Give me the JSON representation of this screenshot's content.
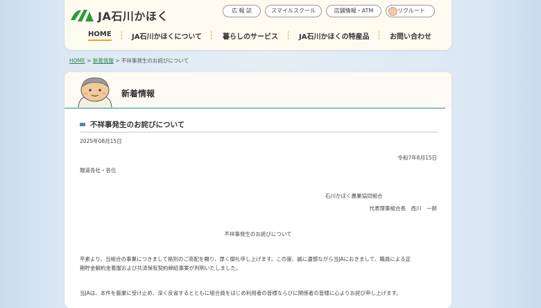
{
  "header": {
    "logo_text": "JA石川かほく",
    "top_links": [
      "広 報 誌",
      "スマイルスクール",
      "店舗情報・ATM",
      "リクルート"
    ],
    "nav": [
      "HOME",
      "JA石川かほくについて",
      "暮らしのサービス",
      "JA石川かほくの特産品",
      "お問い合わせ"
    ]
  },
  "breadcrumb": {
    "home": "HOME",
    "sep1": " > ",
    "news": "新着情報",
    "sep2": " > ",
    "current": "不祥事発生のお詫びについて"
  },
  "section_title": "新着情報",
  "article": {
    "title": "不祥事発生のお詫びについて",
    "post_date": "2025年08月15日",
    "letter_date": "令和7年8月15日",
    "addressee": "報道各社・各位",
    "org": "石川かほく農業協同組合",
    "representative": "代表理事組合長　西川　一郎",
    "heading": "不祥事発生のお詫びについて",
    "para1_line1": "平素より、当組合の事業につきまして格別のご高配を賜り、厚く御礼申し上げます。この度、誠に遺憾ながら当JAにおきまして、職員による定",
    "para1_line2": "期貯金解約金着服および共済保有契約締結事案が判明いたしました。",
    "para2_line1": "当JAは、本件を厳粛に受け止め、深く反省するとともに組合員をはじめ利用者の皆様ならびに関係者の皆様に心よりお詫び申し上げます。"
  },
  "colors": {
    "brand_green": "#2a9a3a",
    "nav_accent": "#e5a51e",
    "divider_blue": "#7fc0d4",
    "title_marker": "#4a87c5"
  }
}
